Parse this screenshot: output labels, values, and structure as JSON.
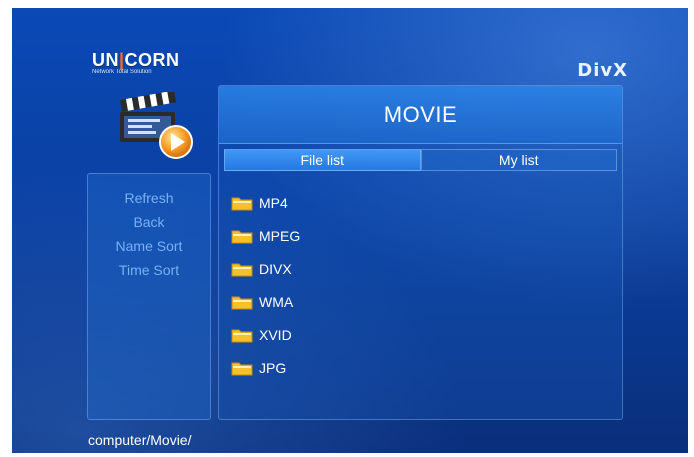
{
  "logo": {
    "brand_left": "UN",
    "brand_right": "CORN",
    "tagline": "Network Total Solution"
  },
  "divx_logo": "DivX",
  "panel": {
    "title": "MOVIE",
    "tabs": [
      {
        "label": "File list",
        "active": true
      },
      {
        "label": "My list",
        "active": false
      }
    ]
  },
  "menu": {
    "items": [
      {
        "label": "Refresh"
      },
      {
        "label": "Back"
      },
      {
        "label": "Name Sort"
      },
      {
        "label": "Time Sort"
      }
    ]
  },
  "files": [
    {
      "name": "MP4",
      "icon": "folder-icon"
    },
    {
      "name": "MPEG",
      "icon": "folder-icon"
    },
    {
      "name": "DIVX",
      "icon": "folder-icon"
    },
    {
      "name": "WMA",
      "icon": "folder-icon"
    },
    {
      "name": "XVID",
      "icon": "folder-icon"
    },
    {
      "name": "JPG",
      "icon": "folder-icon"
    }
  ],
  "path": "computer/Movie/",
  "colors": {
    "accent": "#2f8cff",
    "menu_text": "#79b0f6",
    "folder": "#f4c12a",
    "play": "#f7a22a"
  }
}
